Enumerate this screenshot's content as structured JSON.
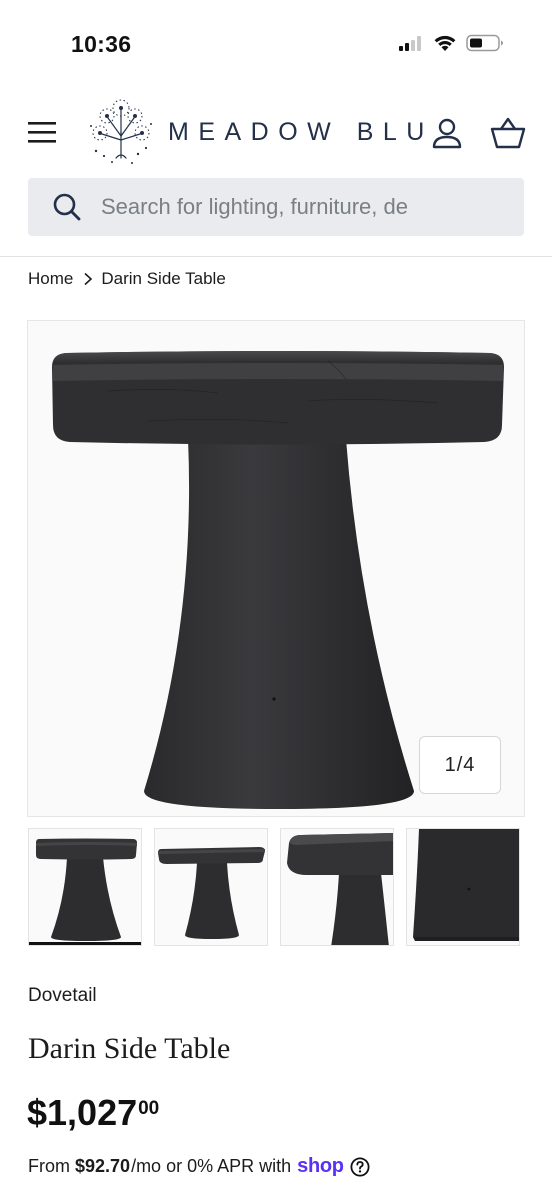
{
  "status_bar": {
    "time": "10:36",
    "icons": [
      "cellular-signal-icon",
      "wifi-icon",
      "battery-icon"
    ]
  },
  "header": {
    "menu_icon": "hamburger-menu-icon",
    "logo_icon": "dandelion-logo-icon",
    "logo_text": "MEADOW BLU",
    "account_icon": "account-icon",
    "cart_icon": "basket-icon"
  },
  "search": {
    "placeholder": "Search for lighting, furniture, de",
    "icon": "search-icon"
  },
  "breadcrumb": {
    "home": "Home",
    "current": "Darin Side Table"
  },
  "gallery": {
    "counter": "1/4",
    "current_index": 1,
    "total": 4,
    "thumbnails": [
      "thumb-front-view",
      "thumb-angle-view",
      "thumb-top-detail",
      "thumb-base-detail"
    ]
  },
  "product": {
    "vendor": "Dovetail",
    "title": "Darin Side Table",
    "price_main": "$1,027",
    "price_cents": "00",
    "installment_prefix": "From",
    "installment_amount": "$92.70",
    "installment_suffix": "/mo or 0% APR with",
    "shop_label": "shop"
  },
  "colors": {
    "brand_navy": "#24304a",
    "shop_purple": "#5a31f4",
    "search_bg": "#e9ebee",
    "table_wood": "#2b2b2d"
  }
}
